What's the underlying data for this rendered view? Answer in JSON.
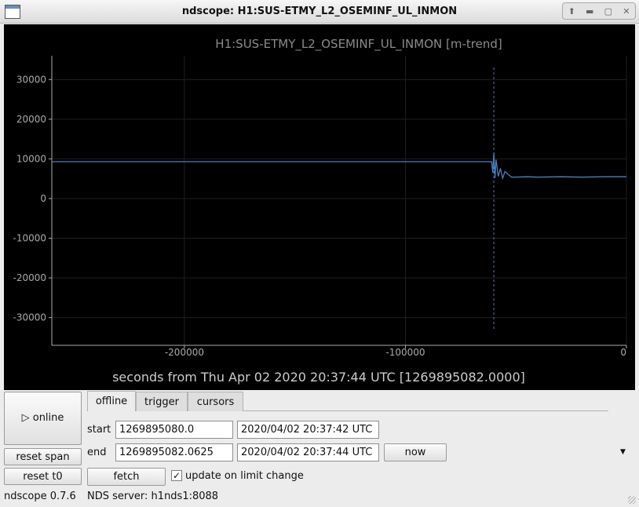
{
  "window": {
    "title": "ndscope: H1:SUS-ETMY_L2_OSEMINF_UL_INMON",
    "controls": [
      "up-icon",
      "minimize-icon",
      "maximize-icon",
      "close-icon"
    ]
  },
  "chart_data": {
    "type": "line",
    "title": "H1:SUS-ETMY_L2_OSEMINF_UL_INMON [m-trend]",
    "xlabel": "seconds from Thu Apr 02 2020 20:37:44 UTC [1269895082.0000]",
    "ylabel": "",
    "xlim": [
      -260000,
      0
    ],
    "ylim": [
      -37000,
      36000
    ],
    "xticks": [
      -200000,
      -100000,
      0
    ],
    "xtick_labels": [
      "-200000",
      "-100000",
      "0"
    ],
    "yticks": [
      30000,
      20000,
      10000,
      0,
      -10000,
      -20000,
      -30000
    ],
    "ytick_labels": [
      "30000",
      "20000",
      "10000",
      "0",
      "-10000",
      "-20000",
      "-30000"
    ],
    "grid": true,
    "line_color": "#4a7fbf",
    "series": [
      {
        "x": [
          -260000,
          -200000,
          -150000,
          -100000,
          -75000,
          -65000,
          -61000,
          -60500,
          -60000,
          -59500,
          -59000,
          -58000,
          -57000,
          -56000,
          -55000,
          -52000,
          -50000,
          -45000,
          -40000,
          -30000,
          -20000,
          -10000,
          0
        ],
        "y": [
          9300,
          9300,
          9300,
          9300,
          9300,
          9300,
          9300,
          6500,
          11500,
          5200,
          9800,
          5600,
          7600,
          5100,
          6800,
          5400,
          5400,
          5500,
          5400,
          5500,
          5400,
          5500,
          5500
        ]
      }
    ],
    "vline_x": -60000,
    "vline_range": [
      -33000,
      33000
    ]
  },
  "tabs": [
    "offline",
    "trigger",
    "cursors"
  ],
  "online_label": "online",
  "play_icon": "▷",
  "reset_span_label": "reset span",
  "reset_t0_label": "reset t0",
  "start_label": "start",
  "end_label": "end",
  "start_gps": "1269895080.0",
  "start_utc": "2020/04/02 20:37:42 UTC",
  "end_gps": "1269895082.0625",
  "end_utc": "2020/04/02 20:37:44 UTC",
  "now_label": "now",
  "fetch_label": "fetch",
  "update_label": "update on limit change",
  "update_checked": true,
  "checkmark": "✓",
  "status": {
    "version": "ndscope 0.7.6",
    "server": "NDS server: h1nds1:8088"
  }
}
